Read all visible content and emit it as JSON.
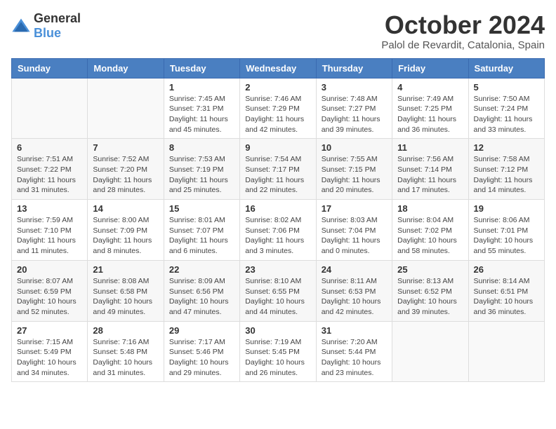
{
  "logo": {
    "general": "General",
    "blue": "Blue"
  },
  "title": "October 2024",
  "location": "Palol de Revardit, Catalonia, Spain",
  "headers": [
    "Sunday",
    "Monday",
    "Tuesday",
    "Wednesday",
    "Thursday",
    "Friday",
    "Saturday"
  ],
  "weeks": [
    [
      {
        "day": "",
        "info": ""
      },
      {
        "day": "",
        "info": ""
      },
      {
        "day": "1",
        "info": "Sunrise: 7:45 AM\nSunset: 7:31 PM\nDaylight: 11 hours and 45 minutes."
      },
      {
        "day": "2",
        "info": "Sunrise: 7:46 AM\nSunset: 7:29 PM\nDaylight: 11 hours and 42 minutes."
      },
      {
        "day": "3",
        "info": "Sunrise: 7:48 AM\nSunset: 7:27 PM\nDaylight: 11 hours and 39 minutes."
      },
      {
        "day": "4",
        "info": "Sunrise: 7:49 AM\nSunset: 7:25 PM\nDaylight: 11 hours and 36 minutes."
      },
      {
        "day": "5",
        "info": "Sunrise: 7:50 AM\nSunset: 7:24 PM\nDaylight: 11 hours and 33 minutes."
      }
    ],
    [
      {
        "day": "6",
        "info": "Sunrise: 7:51 AM\nSunset: 7:22 PM\nDaylight: 11 hours and 31 minutes."
      },
      {
        "day": "7",
        "info": "Sunrise: 7:52 AM\nSunset: 7:20 PM\nDaylight: 11 hours and 28 minutes."
      },
      {
        "day": "8",
        "info": "Sunrise: 7:53 AM\nSunset: 7:19 PM\nDaylight: 11 hours and 25 minutes."
      },
      {
        "day": "9",
        "info": "Sunrise: 7:54 AM\nSunset: 7:17 PM\nDaylight: 11 hours and 22 minutes."
      },
      {
        "day": "10",
        "info": "Sunrise: 7:55 AM\nSunset: 7:15 PM\nDaylight: 11 hours and 20 minutes."
      },
      {
        "day": "11",
        "info": "Sunrise: 7:56 AM\nSunset: 7:14 PM\nDaylight: 11 hours and 17 minutes."
      },
      {
        "day": "12",
        "info": "Sunrise: 7:58 AM\nSunset: 7:12 PM\nDaylight: 11 hours and 14 minutes."
      }
    ],
    [
      {
        "day": "13",
        "info": "Sunrise: 7:59 AM\nSunset: 7:10 PM\nDaylight: 11 hours and 11 minutes."
      },
      {
        "day": "14",
        "info": "Sunrise: 8:00 AM\nSunset: 7:09 PM\nDaylight: 11 hours and 8 minutes."
      },
      {
        "day": "15",
        "info": "Sunrise: 8:01 AM\nSunset: 7:07 PM\nDaylight: 11 hours and 6 minutes."
      },
      {
        "day": "16",
        "info": "Sunrise: 8:02 AM\nSunset: 7:06 PM\nDaylight: 11 hours and 3 minutes."
      },
      {
        "day": "17",
        "info": "Sunrise: 8:03 AM\nSunset: 7:04 PM\nDaylight: 11 hours and 0 minutes."
      },
      {
        "day": "18",
        "info": "Sunrise: 8:04 AM\nSunset: 7:02 PM\nDaylight: 10 hours and 58 minutes."
      },
      {
        "day": "19",
        "info": "Sunrise: 8:06 AM\nSunset: 7:01 PM\nDaylight: 10 hours and 55 minutes."
      }
    ],
    [
      {
        "day": "20",
        "info": "Sunrise: 8:07 AM\nSunset: 6:59 PM\nDaylight: 10 hours and 52 minutes."
      },
      {
        "day": "21",
        "info": "Sunrise: 8:08 AM\nSunset: 6:58 PM\nDaylight: 10 hours and 49 minutes."
      },
      {
        "day": "22",
        "info": "Sunrise: 8:09 AM\nSunset: 6:56 PM\nDaylight: 10 hours and 47 minutes."
      },
      {
        "day": "23",
        "info": "Sunrise: 8:10 AM\nSunset: 6:55 PM\nDaylight: 10 hours and 44 minutes."
      },
      {
        "day": "24",
        "info": "Sunrise: 8:11 AM\nSunset: 6:53 PM\nDaylight: 10 hours and 42 minutes."
      },
      {
        "day": "25",
        "info": "Sunrise: 8:13 AM\nSunset: 6:52 PM\nDaylight: 10 hours and 39 minutes."
      },
      {
        "day": "26",
        "info": "Sunrise: 8:14 AM\nSunset: 6:51 PM\nDaylight: 10 hours and 36 minutes."
      }
    ],
    [
      {
        "day": "27",
        "info": "Sunrise: 7:15 AM\nSunset: 5:49 PM\nDaylight: 10 hours and 34 minutes."
      },
      {
        "day": "28",
        "info": "Sunrise: 7:16 AM\nSunset: 5:48 PM\nDaylight: 10 hours and 31 minutes."
      },
      {
        "day": "29",
        "info": "Sunrise: 7:17 AM\nSunset: 5:46 PM\nDaylight: 10 hours and 29 minutes."
      },
      {
        "day": "30",
        "info": "Sunrise: 7:19 AM\nSunset: 5:45 PM\nDaylight: 10 hours and 26 minutes."
      },
      {
        "day": "31",
        "info": "Sunrise: 7:20 AM\nSunset: 5:44 PM\nDaylight: 10 hours and 23 minutes."
      },
      {
        "day": "",
        "info": ""
      },
      {
        "day": "",
        "info": ""
      }
    ]
  ]
}
